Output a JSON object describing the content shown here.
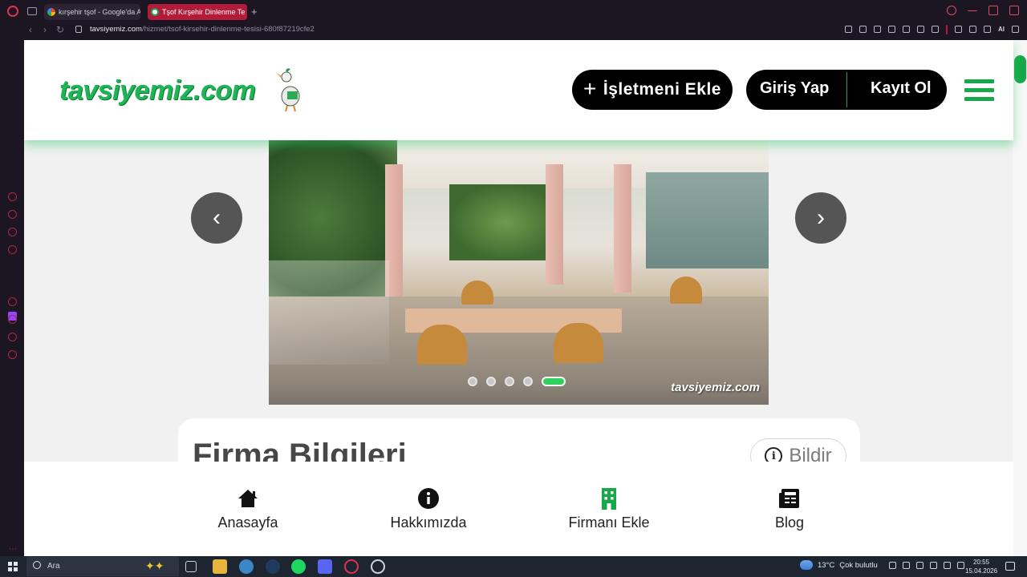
{
  "browser": {
    "tabs": [
      {
        "title": "kırşehir tşof - Google'da A"
      },
      {
        "title": "Tşof Kırşehir Dinlenme Te"
      }
    ],
    "new_tab": "+",
    "url_host": "tavsiyemiz.com",
    "url_path": "/hizmet/tsof-kirsehir-dinlenme-tesisi-680f87219cfe2",
    "ai_label": "AI"
  },
  "site": {
    "logo": "tavsiyemiz.com",
    "add_business": "İşletmeni Ekle",
    "add_plus": "+",
    "login": "Giriş Yap",
    "register": "Kayıt Ol",
    "brand_color": "#18a74a"
  },
  "carousel": {
    "watermark": "tavsiyemiz.com",
    "prev": "‹",
    "next": "›",
    "slide_count": 5,
    "active_slide": 5
  },
  "info_card": {
    "title": "Firma Bilgileri",
    "report": "Bildir",
    "report_icon": "i"
  },
  "bottom_nav": [
    {
      "label": "Anasayfa",
      "icon": "home-icon"
    },
    {
      "label": "Hakkımızda",
      "icon": "info-icon"
    },
    {
      "label": "Firmanı Ekle",
      "icon": "building-icon"
    },
    {
      "label": "Blog",
      "icon": "newspaper-icon"
    }
  ],
  "taskbar": {
    "search": "Ara",
    "weather_temp": "13°C",
    "weather_text": "Çok bulutlu",
    "time": "20:55",
    "date": "15.04.2026"
  }
}
